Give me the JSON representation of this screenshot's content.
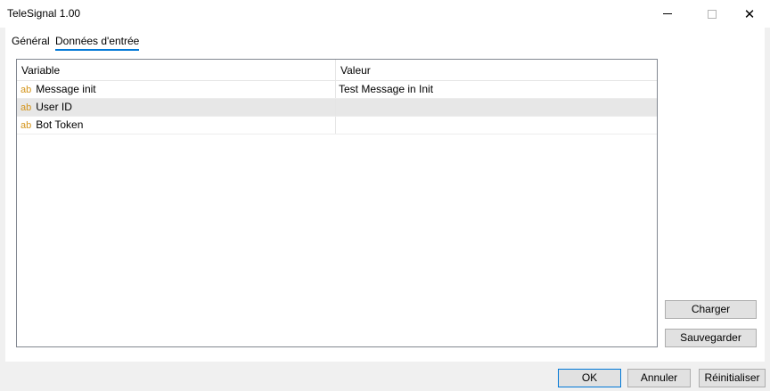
{
  "window": {
    "title": "TeleSignal 1.00",
    "minimize_icon": "minimize-icon",
    "maximize_icon": "maximize-icon",
    "close_icon": "close-icon",
    "close_glyph": "✕"
  },
  "tabs": [
    {
      "label": "Général",
      "active": false
    },
    {
      "label": "Données d'entrée",
      "active": true
    }
  ],
  "grid": {
    "columns": [
      "Variable",
      "Valeur"
    ],
    "type_icon": "ab",
    "rows": [
      {
        "variable": "Message init",
        "value": "Test Message in Init",
        "selected": false
      },
      {
        "variable": "User ID",
        "value": "",
        "selected": true
      },
      {
        "variable": "Bot Token",
        "value": "",
        "selected": false
      }
    ]
  },
  "side_buttons": {
    "load": "Charger",
    "save": "Sauvegarder"
  },
  "footer": {
    "ok": "OK",
    "cancel": "Annuler",
    "reset": "Réinitialiser"
  },
  "colors": {
    "accent": "#0078d7",
    "type_icon": "#d4951c",
    "selected_row": "#e7e7e7"
  }
}
